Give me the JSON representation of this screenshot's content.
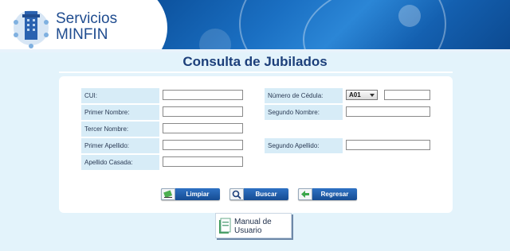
{
  "header": {
    "logo_line1": "Servicios",
    "logo_line2": "MINFIN"
  },
  "page": {
    "title": "Consulta de Jubilados"
  },
  "form": {
    "cui_label": "CUI:",
    "cedula_label": "Número de Cédula:",
    "cedula_prefix_value": "A01",
    "primer_nombre_label": "Primer Nombre:",
    "segundo_nombre_label": "Segundo Nombre:",
    "tercer_nombre_label": "Tercer Nombre:",
    "primer_apellido_label": "Primer Apellido:",
    "segundo_apellido_label": "Segundo Apellido:",
    "apellido_casada_label": "Apellido Casada:"
  },
  "buttons": {
    "limpiar": "Limpiar",
    "buscar": "Buscar",
    "regresar": "Regresar"
  },
  "manual": {
    "line1": "Manual de",
    "line2": "Usuario"
  },
  "colors": {
    "brand_blue": "#1f4c8f",
    "title_blue": "#1c3f7a",
    "page_bg": "#e3f3fb",
    "label_bg": "#d7ecf7",
    "button_blue": "#1f5fae"
  }
}
